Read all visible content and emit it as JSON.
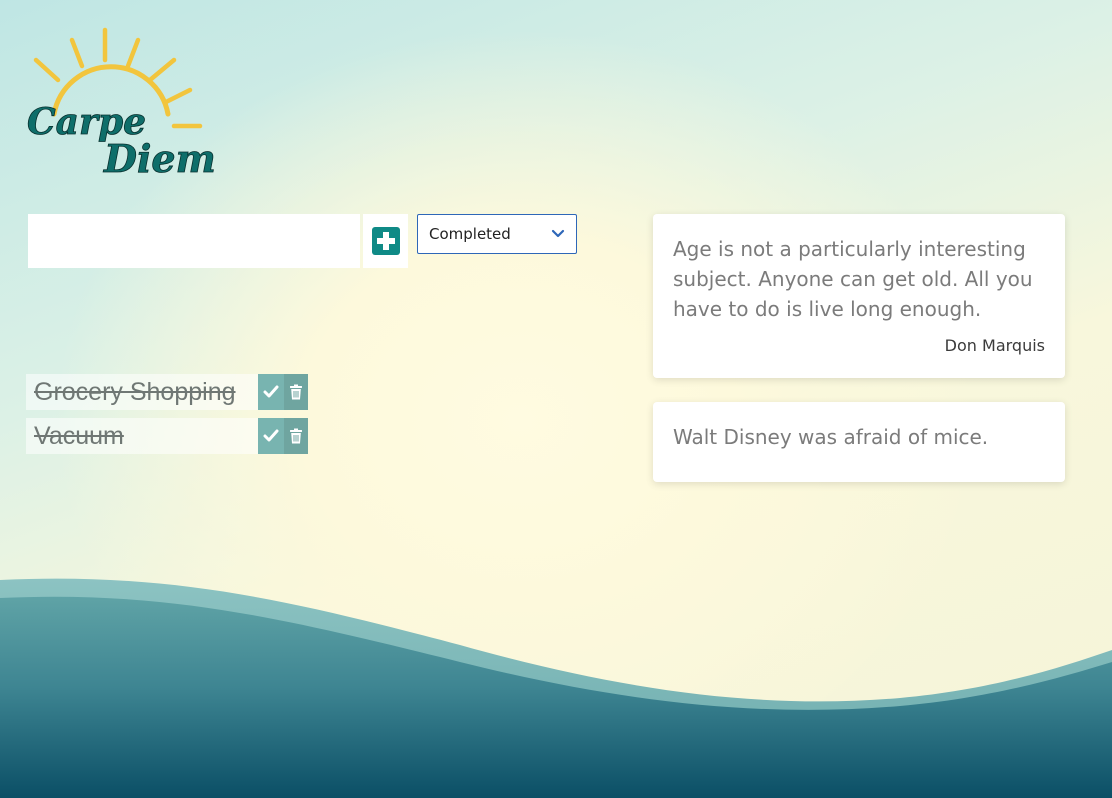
{
  "logo": {
    "line1": "Carpe",
    "line2": "Diem",
    "icon": "sun-icon"
  },
  "todo_form": {
    "input_value": "",
    "input_placeholder": "",
    "add_icon": "plus-square-icon",
    "filter_selected": "Completed",
    "filter_icon": "chevron-down-icon"
  },
  "todos": [
    {
      "text": "Grocery Shopping",
      "completed": true
    },
    {
      "text": "Vacuum",
      "completed": true
    }
  ],
  "quotes": [
    {
      "text": "Age is not a particularly interesting subject. Anyone can get old. All you have to do is live long enough.",
      "author": "Don Marquis"
    },
    {
      "text": "Walt Disney was afraid of mice.",
      "author": ""
    }
  ],
  "colors": {
    "accent": "#0f8a86",
    "logo_yellow": "#f2c53d",
    "logo_teal": "#0e6e6a",
    "wave_dark": "#0a4f66",
    "select_border": "#2e67b8"
  }
}
